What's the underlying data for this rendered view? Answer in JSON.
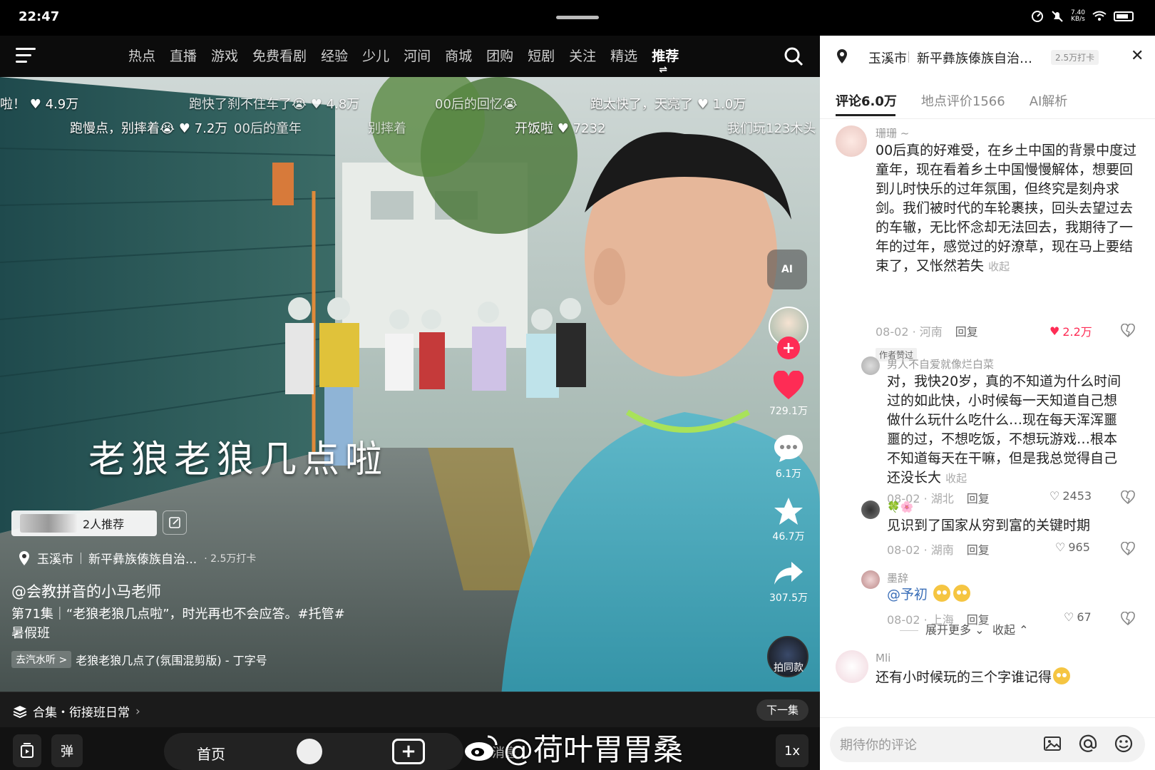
{
  "status": {
    "time": "22:47",
    "net_speed": "7.40",
    "net_unit": "KB/s",
    "battery": "66"
  },
  "nav": {
    "tabs": [
      "热点",
      "直播",
      "游戏",
      "免费看剧",
      "经验",
      "少儿",
      "河间",
      "商城",
      "团购",
      "短剧",
      "关注",
      "精选",
      "推荐"
    ],
    "active_tab": "推荐",
    "active_marker": "⇌"
  },
  "danmaku": [
    {
      "text": "啦！",
      "likes": "4.9万"
    },
    {
      "text": "跑快了刹不住车了😭",
      "likes": "4.8万"
    },
    {
      "text": "00后的回忆😭"
    },
    {
      "text": "跑太快了，天亮了",
      "likes": "1.0万"
    },
    {
      "text": "跑慢点，别摔着😭",
      "likes": "7.2万"
    },
    {
      "text": "00后的童年"
    },
    {
      "text": "别摔着"
    },
    {
      "text": "开饭啦",
      "likes": "7232"
    },
    {
      "text": "我们玩123木头"
    }
  ],
  "video": {
    "caption": "老狼老狼几点啦",
    "recommend": "2人推荐",
    "location": "玉溪市",
    "area": "新平彝族傣族自治...",
    "checkins": "· 2.5万打卡",
    "author": "@会教拼音的小马老师",
    "description": "第71集｜“老狼老狼几点啦”，时光再也不会应答。#托管#暑假班",
    "music_tag": "去汽水听 >",
    "music": "老狼老狼几点了(氛围混剪版) - 丁字号",
    "collection": "合集・衔接班日常",
    "next": "下一集"
  },
  "side": {
    "ai": "AI",
    "likes": "729.1万",
    "comments": "6.1万",
    "favorites": "46.7万",
    "shares": "307.5万",
    "same": "拍同款"
  },
  "bottom": {
    "danmaku_btn": "弹",
    "home": "首页",
    "messages": "消息",
    "speed": "1x",
    "watermark": "@荷叶胃胃桑"
  },
  "panel": {
    "city": "玉溪市",
    "area": "新平彝族傣族自治…",
    "checkin": "2.5万打卡",
    "tabs": [
      "评论6.0万",
      "地点评价1566",
      "AI解析"
    ],
    "comments": [
      {
        "name": "珊珊 ~",
        "text": "00后真的好难受，在乡土中国的背景中度过童年，现在看着乡土中国慢慢解体，想要回到儿时快乐的过年氛围，但终究是刻舟求剑。我们被时代的车轮裹挟，回头去望过去的车辙，无比怀念却无法回去，我期待了一年的过年，感觉过的好潦草，现在马上要结束了，又怅然若失",
        "fold": "收起",
        "meta": "08-02 · 河南",
        "reply": "回复",
        "likes": "2.2万",
        "badge": "作者赞过"
      },
      {
        "name": "男人不自爱就像烂白菜",
        "text": "对，我快20岁，真的不知道为什么时间过的如此快，小时候每一天知道自己想做什么玩什么吃什么…现在每天浑浑噩噩的过，不想吃饭，不想玩游戏…根本不知道每天在干嘛，但是我总觉得自己还没长大",
        "fold": "收起",
        "meta": "08-02 · 湖北",
        "reply": "回复",
        "likes": "2453"
      },
      {
        "name": "🍀🌸",
        "text": "见识到了国家从穷到富的关键时期",
        "meta": "08-02 · 湖南",
        "reply": "回复",
        "likes": "965"
      },
      {
        "name": "墨辞",
        "text": "@予初",
        "meta": "08-02 · 上海",
        "reply": "回复",
        "likes": "67"
      },
      {
        "name": "Mli",
        "text": "还有小时候玩的三个字谁记得"
      }
    ],
    "expand": "展开更多",
    "collapse": "收起",
    "input_placeholder": "期待你的评论"
  }
}
